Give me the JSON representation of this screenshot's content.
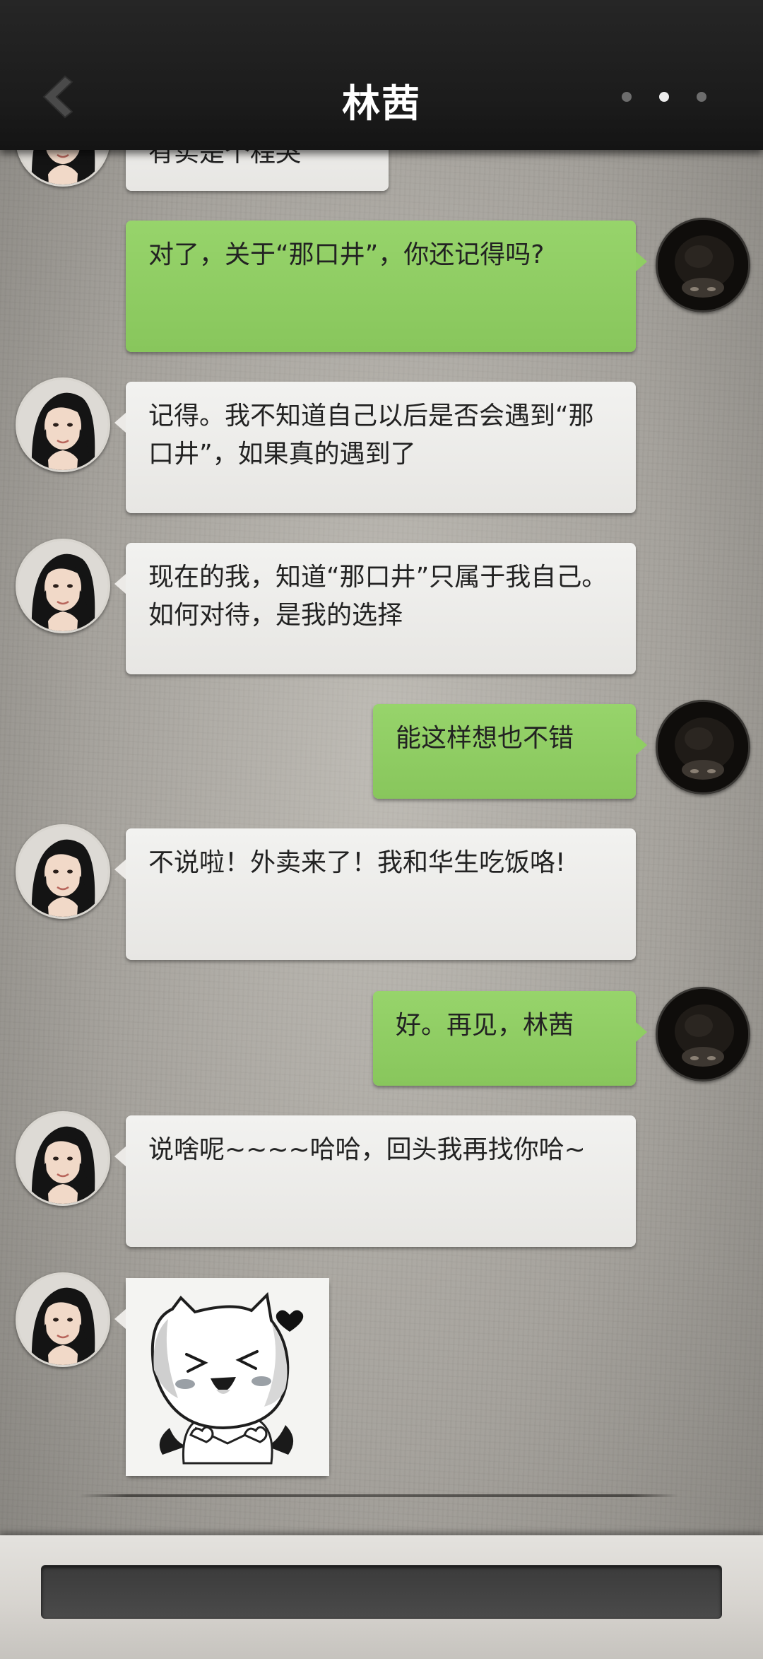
{
  "header": {
    "title": "林茜",
    "back_icon": "chevron-left-icon",
    "more_icon": "more-dots-icon"
  },
  "messages": [
    {
      "side": "in",
      "type": "text",
      "text": "有实是个程哭"
    },
    {
      "side": "out",
      "type": "text",
      "text": "对了，关于“那口井”，你还记得吗?"
    },
    {
      "side": "in",
      "type": "text",
      "text": "记得。我不知道自己以后是否会遇到“那口井”，如果真的遇到了"
    },
    {
      "side": "in",
      "type": "text",
      "text": "现在的我，知道“那口井”只属于我自己。如何对待，是我的选择"
    },
    {
      "side": "out",
      "type": "text",
      "text": "能这样想也不错"
    },
    {
      "side": "in",
      "type": "text",
      "text": "不说啦！外卖来了！我和华生吃饭咯!"
    },
    {
      "side": "out",
      "type": "text",
      "text": "好。再见，林茜"
    },
    {
      "side": "in",
      "type": "text",
      "text": "说啥呢~~~~哈哈，回头我再找你哈~"
    },
    {
      "side": "in",
      "type": "sticker",
      "sticker": "laughing-cat-sticker"
    }
  ],
  "input": {
    "placeholder": "",
    "value": ""
  },
  "colors": {
    "header_bg": "#1b1b1b",
    "outgoing_bubble": "#8fce63",
    "incoming_bubble": "#eceae7",
    "background": "#a3a09a"
  }
}
